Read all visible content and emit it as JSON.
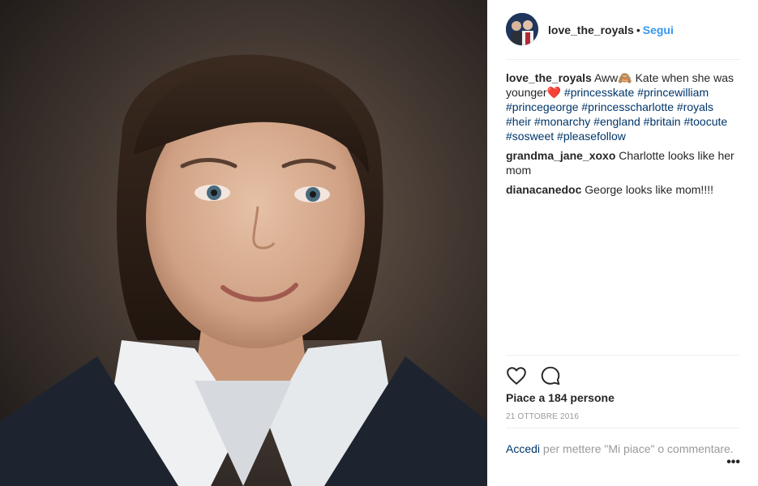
{
  "post": {
    "username": "love_the_royals",
    "separator": "•",
    "follow_label": "Segui"
  },
  "comments": [
    {
      "user": "love_the_royals",
      "text_before": " Aww🙈 Kate when she was younger",
      "heart": "❤️",
      "hashtags": "#princesskate #princewilliam #princegeorge #princesscharlotte #royals #heir #monarchy #england #britain #toocute #sosweet #pleasefollow"
    },
    {
      "user": "grandma_jane_xoxo",
      "text": " Charlotte looks like her mom"
    },
    {
      "user": "dianacanedoc",
      "text": " George looks like mom!!!!"
    }
  ],
  "actions": {
    "like_icon": "heart-outline-icon",
    "comment_icon": "speech-bubble-icon"
  },
  "likes_text": "Piace a 184 persone",
  "date": "21 ottobre 2016",
  "login": {
    "link": "Accedi",
    "rest": " per mettere \"Mi piace\" o commentare."
  },
  "more_label": "•••"
}
